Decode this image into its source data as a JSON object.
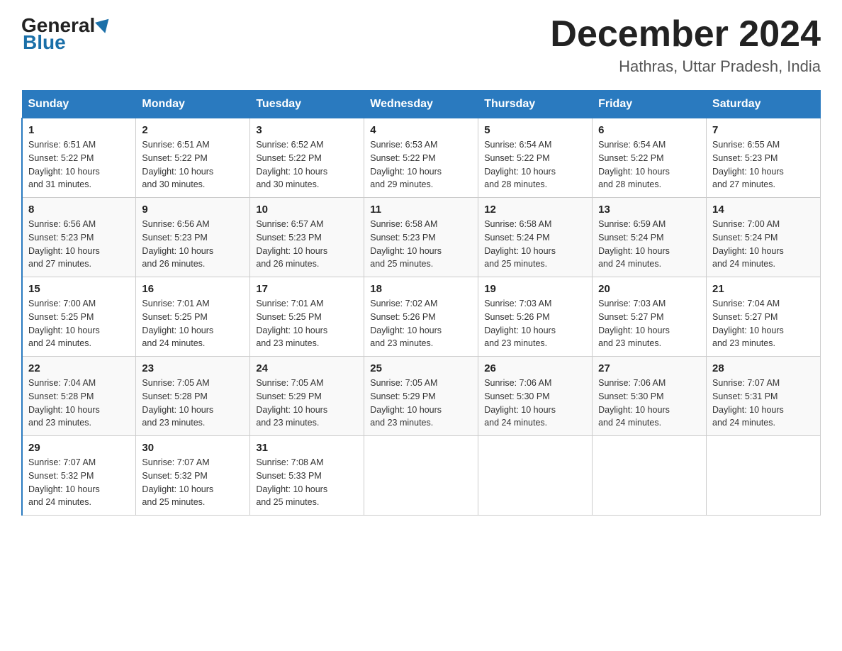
{
  "header": {
    "logo_general": "General",
    "logo_blue": "Blue",
    "month_title": "December 2024",
    "location": "Hathras, Uttar Pradesh, India"
  },
  "days_of_week": [
    "Sunday",
    "Monday",
    "Tuesday",
    "Wednesday",
    "Thursday",
    "Friday",
    "Saturday"
  ],
  "weeks": [
    [
      {
        "num": "1",
        "sunrise": "6:51 AM",
        "sunset": "5:22 PM",
        "daylight": "10 hours and 31 minutes."
      },
      {
        "num": "2",
        "sunrise": "6:51 AM",
        "sunset": "5:22 PM",
        "daylight": "10 hours and 30 minutes."
      },
      {
        "num": "3",
        "sunrise": "6:52 AM",
        "sunset": "5:22 PM",
        "daylight": "10 hours and 30 minutes."
      },
      {
        "num": "4",
        "sunrise": "6:53 AM",
        "sunset": "5:22 PM",
        "daylight": "10 hours and 29 minutes."
      },
      {
        "num": "5",
        "sunrise": "6:54 AM",
        "sunset": "5:22 PM",
        "daylight": "10 hours and 28 minutes."
      },
      {
        "num": "6",
        "sunrise": "6:54 AM",
        "sunset": "5:22 PM",
        "daylight": "10 hours and 28 minutes."
      },
      {
        "num": "7",
        "sunrise": "6:55 AM",
        "sunset": "5:23 PM",
        "daylight": "10 hours and 27 minutes."
      }
    ],
    [
      {
        "num": "8",
        "sunrise": "6:56 AM",
        "sunset": "5:23 PM",
        "daylight": "10 hours and 27 minutes."
      },
      {
        "num": "9",
        "sunrise": "6:56 AM",
        "sunset": "5:23 PM",
        "daylight": "10 hours and 26 minutes."
      },
      {
        "num": "10",
        "sunrise": "6:57 AM",
        "sunset": "5:23 PM",
        "daylight": "10 hours and 26 minutes."
      },
      {
        "num": "11",
        "sunrise": "6:58 AM",
        "sunset": "5:23 PM",
        "daylight": "10 hours and 25 minutes."
      },
      {
        "num": "12",
        "sunrise": "6:58 AM",
        "sunset": "5:24 PM",
        "daylight": "10 hours and 25 minutes."
      },
      {
        "num": "13",
        "sunrise": "6:59 AM",
        "sunset": "5:24 PM",
        "daylight": "10 hours and 24 minutes."
      },
      {
        "num": "14",
        "sunrise": "7:00 AM",
        "sunset": "5:24 PM",
        "daylight": "10 hours and 24 minutes."
      }
    ],
    [
      {
        "num": "15",
        "sunrise": "7:00 AM",
        "sunset": "5:25 PM",
        "daylight": "10 hours and 24 minutes."
      },
      {
        "num": "16",
        "sunrise": "7:01 AM",
        "sunset": "5:25 PM",
        "daylight": "10 hours and 24 minutes."
      },
      {
        "num": "17",
        "sunrise": "7:01 AM",
        "sunset": "5:25 PM",
        "daylight": "10 hours and 23 minutes."
      },
      {
        "num": "18",
        "sunrise": "7:02 AM",
        "sunset": "5:26 PM",
        "daylight": "10 hours and 23 minutes."
      },
      {
        "num": "19",
        "sunrise": "7:03 AM",
        "sunset": "5:26 PM",
        "daylight": "10 hours and 23 minutes."
      },
      {
        "num": "20",
        "sunrise": "7:03 AM",
        "sunset": "5:27 PM",
        "daylight": "10 hours and 23 minutes."
      },
      {
        "num": "21",
        "sunrise": "7:04 AM",
        "sunset": "5:27 PM",
        "daylight": "10 hours and 23 minutes."
      }
    ],
    [
      {
        "num": "22",
        "sunrise": "7:04 AM",
        "sunset": "5:28 PM",
        "daylight": "10 hours and 23 minutes."
      },
      {
        "num": "23",
        "sunrise": "7:05 AM",
        "sunset": "5:28 PM",
        "daylight": "10 hours and 23 minutes."
      },
      {
        "num": "24",
        "sunrise": "7:05 AM",
        "sunset": "5:29 PM",
        "daylight": "10 hours and 23 minutes."
      },
      {
        "num": "25",
        "sunrise": "7:05 AM",
        "sunset": "5:29 PM",
        "daylight": "10 hours and 23 minutes."
      },
      {
        "num": "26",
        "sunrise": "7:06 AM",
        "sunset": "5:30 PM",
        "daylight": "10 hours and 24 minutes."
      },
      {
        "num": "27",
        "sunrise": "7:06 AM",
        "sunset": "5:30 PM",
        "daylight": "10 hours and 24 minutes."
      },
      {
        "num": "28",
        "sunrise": "7:07 AM",
        "sunset": "5:31 PM",
        "daylight": "10 hours and 24 minutes."
      }
    ],
    [
      {
        "num": "29",
        "sunrise": "7:07 AM",
        "sunset": "5:32 PM",
        "daylight": "10 hours and 24 minutes."
      },
      {
        "num": "30",
        "sunrise": "7:07 AM",
        "sunset": "5:32 PM",
        "daylight": "10 hours and 25 minutes."
      },
      {
        "num": "31",
        "sunrise": "7:08 AM",
        "sunset": "5:33 PM",
        "daylight": "10 hours and 25 minutes."
      },
      null,
      null,
      null,
      null
    ]
  ],
  "labels": {
    "sunrise": "Sunrise:",
    "sunset": "Sunset:",
    "daylight": "Daylight:"
  }
}
